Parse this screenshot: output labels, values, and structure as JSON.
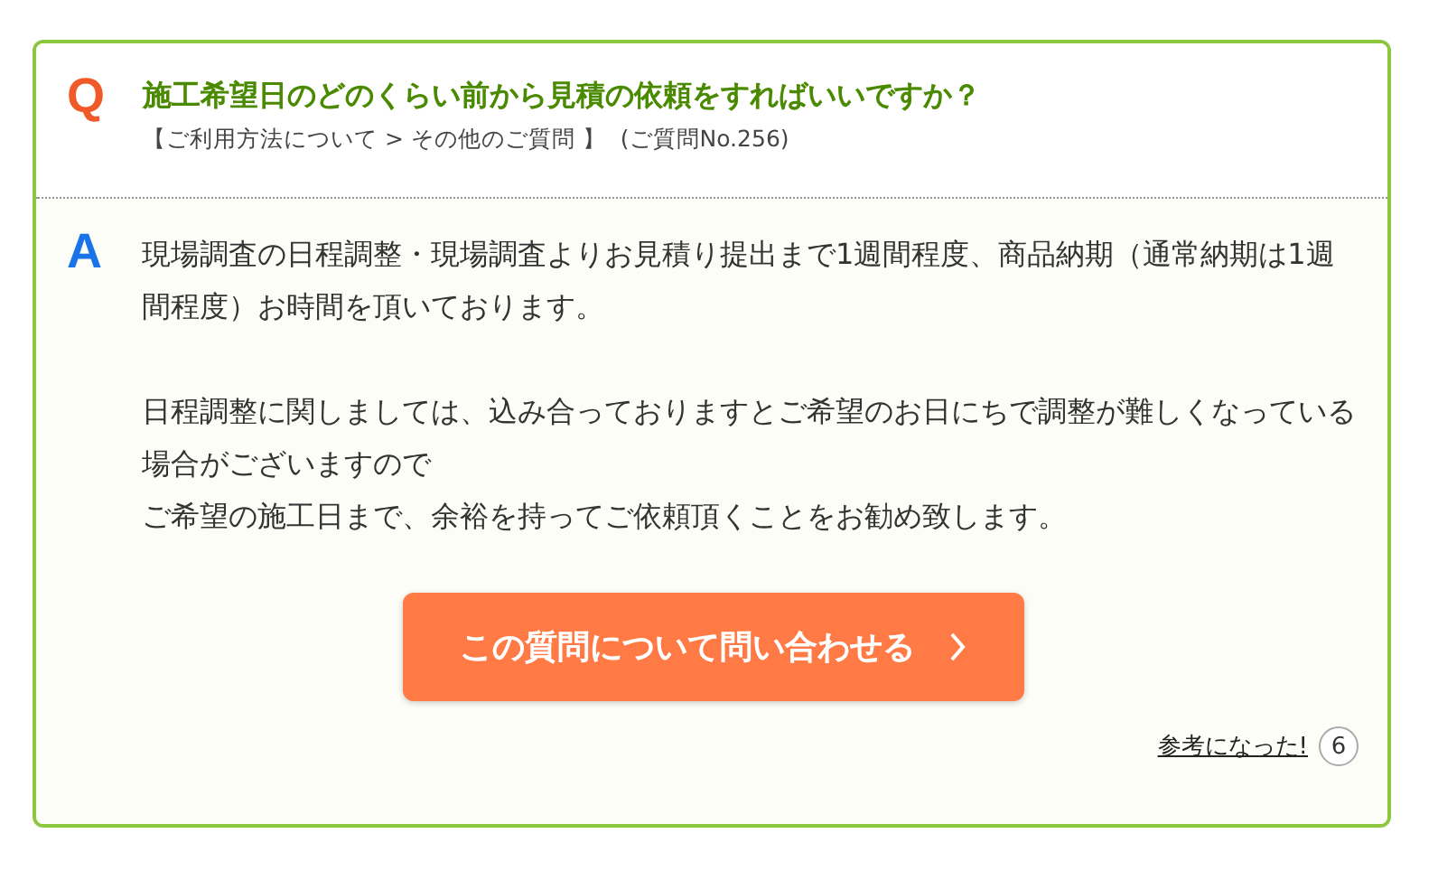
{
  "question": {
    "mark": "Q",
    "title": "施工希望日のどのくらい前から見積の依頼をすればいいですか？",
    "category": "【ご利用方法について > その他のご質問 】",
    "number": "(ご質問No.256)"
  },
  "answer": {
    "mark": "A",
    "paragraphs": [
      [
        "現場調査の日程調整・現場調査よりお見積り提出まで1週間程度、商品納期（通常納期は1週間程度）お時間を頂いております。"
      ],
      [
        "日程調整に関しましては、込み合っておりますとご希望のお日にちで調整が難しくなっている場合がございますので",
        "ご希望の施工日まで、余裕を持ってご依頼頂くことをお勧め致します。"
      ]
    ]
  },
  "contact_button": {
    "label": "この質問について問い合わせる"
  },
  "helpful": {
    "label": "参考になった!",
    "count": "6"
  }
}
